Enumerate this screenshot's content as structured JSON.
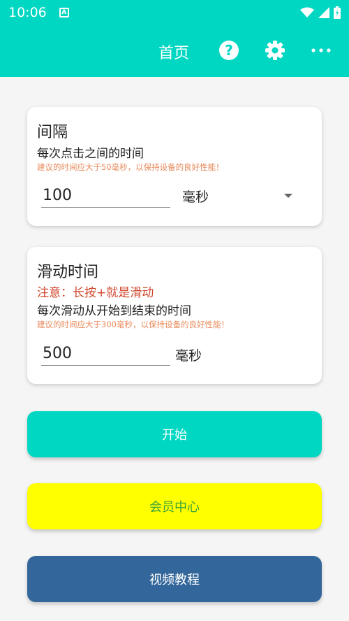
{
  "statusbar": {
    "time": "10:06",
    "notif_letter": "A"
  },
  "appbar": {
    "title": "首页"
  },
  "interval_card": {
    "title": "间隔",
    "subtitle": "每次点击之间的时间",
    "hint": "建议的时间应大于50毫秒，以保持设备的良好性能！",
    "value": "100",
    "unit": "毫秒"
  },
  "swipe_card": {
    "title": "滑动时间",
    "warning": "注意：长按+就是滑动",
    "subtitle": "每次滑动从开始到结束的时间",
    "hint": "建议的时间应大于300毫秒，以保持设备的良好性能！",
    "value": "500",
    "unit": "毫秒"
  },
  "buttons": {
    "start": "开始",
    "member": "会员中心",
    "video": "视频教程"
  },
  "colors": {
    "accent": "#00d7c2",
    "member_bg": "#ffff00",
    "video_bg": "#33669a",
    "warning": "#d0442b",
    "hint": "#e8895a"
  }
}
